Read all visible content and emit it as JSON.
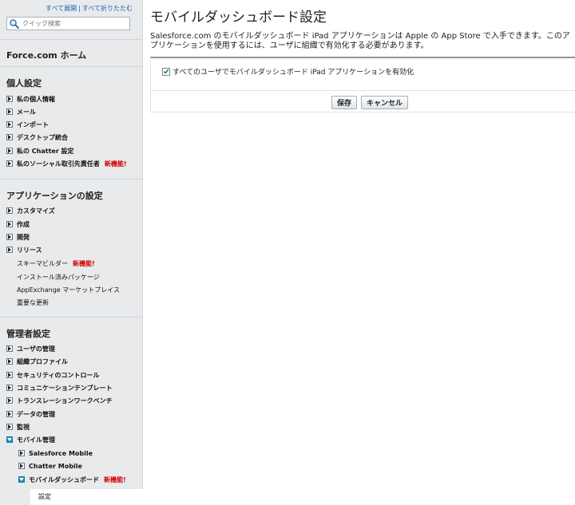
{
  "sidebar": {
    "expand_all": "すべて展開",
    "collapse_all": "すべて折りたたむ",
    "separator": "|",
    "search_placeholder": "クイック検索",
    "home_label": "Force.com ホーム",
    "personal": {
      "heading": "個人設定",
      "items": [
        {
          "label": "私の個人情報"
        },
        {
          "label": "メール"
        },
        {
          "label": "インポート"
        },
        {
          "label": "デスクトップ統合"
        },
        {
          "label": "私の Chatter 設定"
        },
        {
          "label": "私のソーシャル取引先責任者",
          "badge": "新機能!"
        }
      ]
    },
    "app": {
      "heading": "アプリケーションの設定",
      "items": [
        {
          "label": "カスタマイズ"
        },
        {
          "label": "作成"
        },
        {
          "label": "開発"
        },
        {
          "label": "リリース"
        }
      ],
      "links": [
        {
          "label": "スキーマビルダー",
          "badge": "新機能!"
        },
        {
          "label": "インストール済みパッケージ"
        },
        {
          "label": "AppExchange マーケットプレイス"
        },
        {
          "label": "重要な更新"
        }
      ]
    },
    "admin": {
      "heading": "管理者設定",
      "items": [
        {
          "label": "ユーザの管理"
        },
        {
          "label": "組織プロファイル"
        },
        {
          "label": "セキュリティのコントロール"
        },
        {
          "label": "コミュニケーションテンプレート"
        },
        {
          "label": "トランスレーションワークベンチ"
        },
        {
          "label": "データの管理"
        },
        {
          "label": "監視"
        },
        {
          "label": "モバイル管理"
        }
      ],
      "mobile_children": [
        {
          "label": "Salesforce Mobile"
        },
        {
          "label": "Chatter Mobile"
        },
        {
          "label": "モバイルダッシュボード",
          "badge": "新機能!"
        }
      ],
      "selected": "設定"
    }
  },
  "main": {
    "title": "モバイルダッシュボード設定",
    "description": "Salesforce.com のモバイルダッシュボード iPad アプリケーションは Apple の App Store で入手できます。このアプリケーションを使用するには、ユーザに組織で有効化する必要があります。",
    "checkbox_label": "すべてのユーザでモバイルダッシュボード iPad アプリケーションを有効化",
    "checkbox_checked": true,
    "save_label": "保存",
    "cancel_label": "キャンセル"
  },
  "colors": {
    "accent": "#1b8fb8",
    "new_badge": "#d40000",
    "link": "#1f5fb4"
  }
}
